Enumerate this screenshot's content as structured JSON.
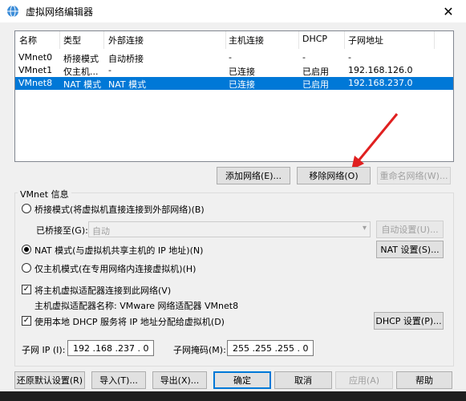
{
  "window": {
    "title": "虚拟网络编辑器",
    "close": "✕"
  },
  "table": {
    "headers": [
      "名称",
      "类型",
      "外部连接",
      "主机连接",
      "DHCP",
      "子网地址"
    ],
    "rows": [
      [
        "VMnet0",
        "桥接模式",
        "自动桥接",
        "-",
        "-",
        "-"
      ],
      [
        "VMnet1",
        "仅主机...",
        "-",
        "已连接",
        "已启用",
        "192.168.126.0"
      ],
      [
        "VMnet8",
        "NAT 模式",
        "NAT 模式",
        "已连接",
        "已启用",
        "192.168.237.0"
      ]
    ],
    "selected_row": 2
  },
  "list_buttons": {
    "add": "添加网络(E)...",
    "remove": "移除网络(O)",
    "rename": "重命名网络(W)..."
  },
  "vmnet_info": {
    "label": "VMnet 信息",
    "bridge_radio": "桥接模式(将虚拟机直接连接到外部网络)(B)",
    "bridged_to_label": "已桥接至(G):",
    "bridged_to_value": "自动",
    "auto_settings": "自动设置(U)...",
    "nat_radio": "NAT 模式(与虚拟机共享主机的 IP 地址)(N)",
    "nat_settings": "NAT 设置(S)...",
    "hostonly_radio": "仅主机模式(在专用网络内连接虚拟机)(H)",
    "connect_adapter": "将主机虚拟适配器连接到此网络(V)",
    "adapter_name": "主机虚拟适配器名称: VMware 网络适配器 VMnet8",
    "use_dhcp": "使用本地 DHCP 服务将 IP 地址分配给虚拟机(D)",
    "dhcp_settings": "DHCP 设置(P)...",
    "subnet_ip_label": "子网 IP (I):",
    "subnet_ip": "192 .168 .237 . 0",
    "subnet_mask_label": "子网掩码(M):",
    "subnet_mask": "255 .255 .255 . 0"
  },
  "bottom_buttons": {
    "restore": "还原默认设置(R)",
    "import": "导入(T)...",
    "export": "导出(X)...",
    "ok": "确定",
    "cancel": "取消",
    "apply": "应用(A)",
    "help": "帮助"
  },
  "colors": {
    "selection": "#0078d7",
    "arrow": "#e02020"
  }
}
